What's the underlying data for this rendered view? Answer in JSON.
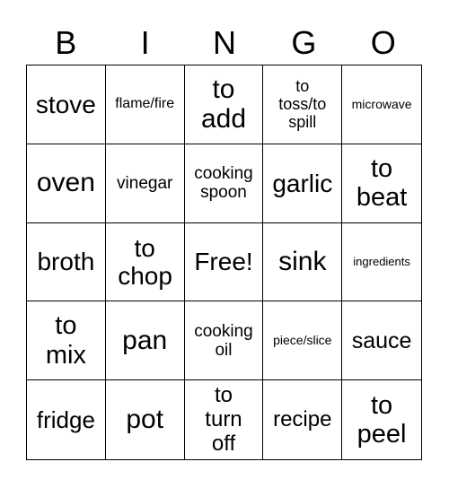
{
  "header": [
    "B",
    "I",
    "N",
    "G",
    "O"
  ],
  "cells": [
    {
      "text": "stove",
      "size": 28
    },
    {
      "text": "flame/fire",
      "size": 16
    },
    {
      "text": "to add",
      "size": 30
    },
    {
      "text": "to toss/to spill",
      "size": 18
    },
    {
      "text": "microwave",
      "size": 14
    },
    {
      "text": "oven",
      "size": 30
    },
    {
      "text": "vinegar",
      "size": 19
    },
    {
      "text": "cooking spoon",
      "size": 19
    },
    {
      "text": "garlic",
      "size": 28
    },
    {
      "text": "to beat",
      "size": 29
    },
    {
      "text": "broth",
      "size": 28
    },
    {
      "text": "to chop",
      "size": 28
    },
    {
      "text": "Free!",
      "size": 28
    },
    {
      "text": "sink",
      "size": 30
    },
    {
      "text": "ingredients",
      "size": 13
    },
    {
      "text": "to mix",
      "size": 29
    },
    {
      "text": "pan",
      "size": 30
    },
    {
      "text": "cooking oil",
      "size": 19
    },
    {
      "text": "piece/slice",
      "size": 14
    },
    {
      "text": "sauce",
      "size": 25
    },
    {
      "text": "fridge",
      "size": 26
    },
    {
      "text": "pot",
      "size": 30
    },
    {
      "text": "to turn off",
      "size": 24
    },
    {
      "text": "recipe",
      "size": 24
    },
    {
      "text": "to peel",
      "size": 29
    }
  ]
}
